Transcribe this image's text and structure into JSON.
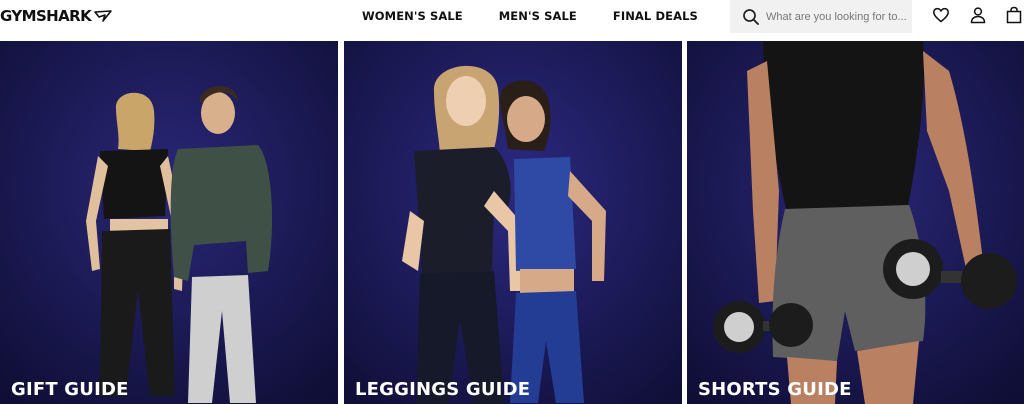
{
  "brand": {
    "name": "GYMSHARK"
  },
  "nav": {
    "links": [
      "WOMEN'S SALE",
      "MEN'S SALE",
      "FINAL DEALS"
    ]
  },
  "search": {
    "placeholder": "What are you looking for to..."
  },
  "icons": {
    "search": "search-icon",
    "wishlist": "heart-icon",
    "account": "user-icon",
    "bag": "shopping-bag-icon"
  },
  "tiles": [
    {
      "caption": "GIFT GUIDE"
    },
    {
      "caption": "LEGGINGS GUIDE"
    },
    {
      "caption": "SHORTS GUIDE"
    }
  ],
  "colors": {
    "tile_background": "#1b1a52",
    "header_background": "#ffffff",
    "text_dark": "#111111",
    "caption": "#ffffff"
  }
}
